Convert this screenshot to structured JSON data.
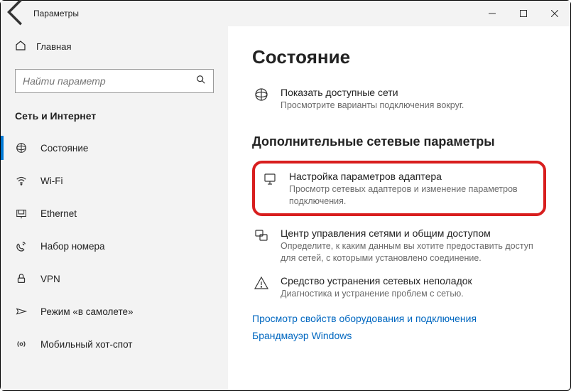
{
  "window": {
    "title": "Параметры"
  },
  "sidebar": {
    "home": "Главная",
    "search_placeholder": "Найти параметр",
    "category": "Сеть и Интернет",
    "items": [
      {
        "label": "Состояние"
      },
      {
        "label": "Wi-Fi"
      },
      {
        "label": "Ethernet"
      },
      {
        "label": "Набор номера"
      },
      {
        "label": "VPN"
      },
      {
        "label": "Режим «в самолете»"
      },
      {
        "label": "Мобильный хот-спот"
      }
    ]
  },
  "main": {
    "title": "Состояние",
    "available": {
      "title": "Показать доступные сети",
      "desc": "Просмотрите варианты подключения вокруг."
    },
    "advanced_header": "Дополнительные сетевые параметры",
    "adapter": {
      "title": "Настройка параметров адаптера",
      "desc": "Просмотр сетевых адаптеров и изменение параметров подключения."
    },
    "sharing": {
      "title": "Центр управления сетями и общим доступом",
      "desc": "Определите, к каким данным вы хотите предоставить доступ для сетей, с которыми установлено соединение."
    },
    "troubleshoot": {
      "title": "Средство устранения сетевых неполадок",
      "desc": "Диагностика и устранение проблем с сетью."
    },
    "links": {
      "hw": "Просмотр свойств оборудования и подключения",
      "fw": "Брандмауэр Windows"
    }
  }
}
